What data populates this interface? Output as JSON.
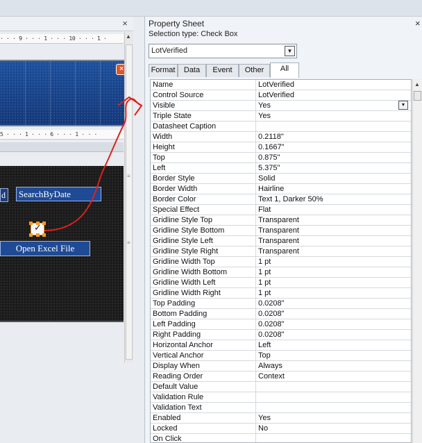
{
  "design": {
    "close_glyph": "×",
    "ruler_top": "· · · 9 · · · 1 · · · 10 · · · 1 ·",
    "ruler_mid": "5 · · · 1 · · · 6 · · · 1 · · ·",
    "header_close_glyph": "×",
    "partial_label": "d",
    "search_label": "SearchByDate",
    "excel_label": "Open Excel File",
    "checkbox_mark": "✓",
    "grip_glyph": "≡"
  },
  "property_sheet": {
    "title": "Property Sheet",
    "close_glyph": "×",
    "selection_type": "Selection type:  Check Box",
    "object_combo": "LotVerified",
    "tabs": [
      {
        "label": "Format"
      },
      {
        "label": "Data"
      },
      {
        "label": "Event"
      },
      {
        "label": "Other"
      },
      {
        "label": "All",
        "active": true
      }
    ],
    "properties": [
      {
        "name": "Name",
        "value": "LotVerified"
      },
      {
        "name": "Control Source",
        "value": "LotVerified"
      },
      {
        "name": "Visible",
        "value": "Yes",
        "dropdown": true
      },
      {
        "name": "Triple State",
        "value": "Yes"
      },
      {
        "name": "Datasheet Caption",
        "value": ""
      },
      {
        "name": "Width",
        "value": "0.2118\""
      },
      {
        "name": "Height",
        "value": "0.1667\""
      },
      {
        "name": "Top",
        "value": "0.875\""
      },
      {
        "name": "Left",
        "value": "5.375\""
      },
      {
        "name": "Border Style",
        "value": "Solid"
      },
      {
        "name": "Border Width",
        "value": "Hairline"
      },
      {
        "name": "Border Color",
        "value": "Text 1, Darker 50%"
      },
      {
        "name": "Special Effect",
        "value": "Flat"
      },
      {
        "name": "Gridline Style Top",
        "value": "Transparent"
      },
      {
        "name": "Gridline Style Bottom",
        "value": "Transparent"
      },
      {
        "name": "Gridline Style Left",
        "value": "Transparent"
      },
      {
        "name": "Gridline Style Right",
        "value": "Transparent"
      },
      {
        "name": "Gridline Width Top",
        "value": "1 pt"
      },
      {
        "name": "Gridline Width Bottom",
        "value": "1 pt"
      },
      {
        "name": "Gridline Width Left",
        "value": "1 pt"
      },
      {
        "name": "Gridline Width Right",
        "value": "1 pt"
      },
      {
        "name": "Top Padding",
        "value": "0.0208\""
      },
      {
        "name": "Bottom Padding",
        "value": "0.0208\""
      },
      {
        "name": "Left Padding",
        "value": "0.0208\""
      },
      {
        "name": "Right Padding",
        "value": "0.0208\""
      },
      {
        "name": "Horizontal Anchor",
        "value": "Left"
      },
      {
        "name": "Vertical Anchor",
        "value": "Top"
      },
      {
        "name": "Display When",
        "value": "Always"
      },
      {
        "name": "Reading Order",
        "value": "Context"
      },
      {
        "name": "Default Value",
        "value": ""
      },
      {
        "name": "Validation Rule",
        "value": ""
      },
      {
        "name": "Validation Text",
        "value": ""
      },
      {
        "name": "Enabled",
        "value": "Yes"
      },
      {
        "name": "Locked",
        "value": "No"
      },
      {
        "name": "On Click",
        "value": ""
      }
    ]
  },
  "colors": {
    "annotation": "#e0201c",
    "selection_handle": "#f29b2a"
  }
}
